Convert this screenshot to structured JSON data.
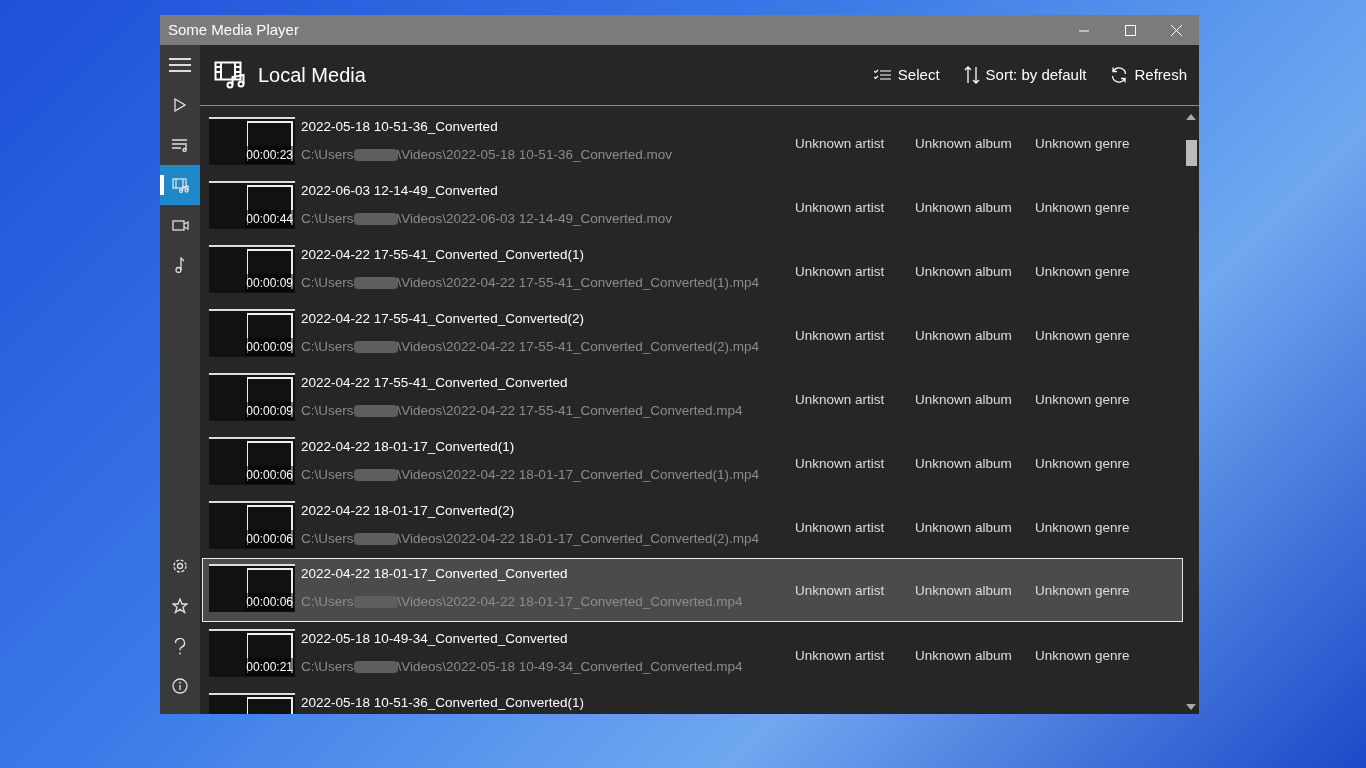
{
  "window": {
    "title": "Some Media Player"
  },
  "sidebar": {
    "items": [
      {
        "selected": false
      },
      {
        "selected": false
      },
      {
        "selected": true
      },
      {
        "selected": false
      },
      {
        "selected": false
      }
    ]
  },
  "header": {
    "title": "Local Media",
    "actions": [
      {
        "label": "Select"
      },
      {
        "label": "Sort: by default"
      },
      {
        "label": "Refresh"
      }
    ]
  },
  "rows": [
    {
      "title": "2022-05-18 10-51-36_Converted",
      "duration": "00:00:23",
      "path_start": "C:\\Users",
      "path_end": "\\Videos\\2022-05-18 10-51-36_Converted.mov",
      "artist": "Unknown artist",
      "album": "Unknown album",
      "genre": "Unknown genre",
      "selected": false
    },
    {
      "title": "2022-06-03 12-14-49_Converted",
      "duration": "00:00:44",
      "path_start": "C:\\Users",
      "path_end": "\\Videos\\2022-06-03 12-14-49_Converted.mov",
      "artist": "Unknown artist",
      "album": "Unknown album",
      "genre": "Unknown genre",
      "selected": false
    },
    {
      "title": "2022-04-22 17-55-41_Converted_Converted(1)",
      "duration": "00:00:09",
      "path_start": "C:\\Users",
      "path_end": "\\Videos\\2022-04-22 17-55-41_Converted_Converted(1).mp4",
      "artist": "Unknown artist",
      "album": "Unknown album",
      "genre": "Unknown genre",
      "selected": false
    },
    {
      "title": "2022-04-22 17-55-41_Converted_Converted(2)",
      "duration": "00:00:09",
      "path_start": "C:\\Users",
      "path_end": "\\Videos\\2022-04-22 17-55-41_Converted_Converted(2).mp4",
      "artist": "Unknown artist",
      "album": "Unknown album",
      "genre": "Unknown genre",
      "selected": false
    },
    {
      "title": "2022-04-22 17-55-41_Converted_Converted",
      "duration": "00:00:09",
      "path_start": "C:\\Users",
      "path_end": "\\Videos\\2022-04-22 17-55-41_Converted_Converted.mp4",
      "artist": "Unknown artist",
      "album": "Unknown album",
      "genre": "Unknown genre",
      "selected": false
    },
    {
      "title": "2022-04-22 18-01-17_Converted(1)",
      "duration": "00:00:06",
      "path_start": "C:\\Users",
      "path_end": "\\Videos\\2022-04-22 18-01-17_Converted_Converted(1).mp4",
      "artist": "Unknown artist",
      "album": "Unknown album",
      "genre": "Unknown genre",
      "selected": false
    },
    {
      "title": "2022-04-22 18-01-17_Converted(2)",
      "duration": "00:00:06",
      "path_start": "C:\\Users",
      "path_end": "\\Videos\\2022-04-22 18-01-17_Converted_Converted(2).mp4",
      "artist": "Unknown artist",
      "album": "Unknown album",
      "genre": "Unknown genre",
      "selected": false
    },
    {
      "title": "2022-04-22 18-01-17_Converted_Converted",
      "duration": "00:00:06",
      "path_start": "C:\\Users",
      "path_end": "\\Videos\\2022-04-22 18-01-17_Converted_Converted.mp4",
      "artist": "Unknown artist",
      "album": "Unknown album",
      "genre": "Unknown genre",
      "selected": true
    },
    {
      "title": "2022-05-18 10-49-34_Converted_Converted",
      "duration": "00:00:21",
      "path_start": "C:\\Users",
      "path_end": "\\Videos\\2022-05-18 10-49-34_Converted_Converted.mp4",
      "artist": "Unknown artist",
      "album": "Unknown album",
      "genre": "Unknown genre",
      "selected": false
    },
    {
      "title": "2022-05-18 10-51-36_Converted_Converted(1)",
      "selected": false
    }
  ]
}
